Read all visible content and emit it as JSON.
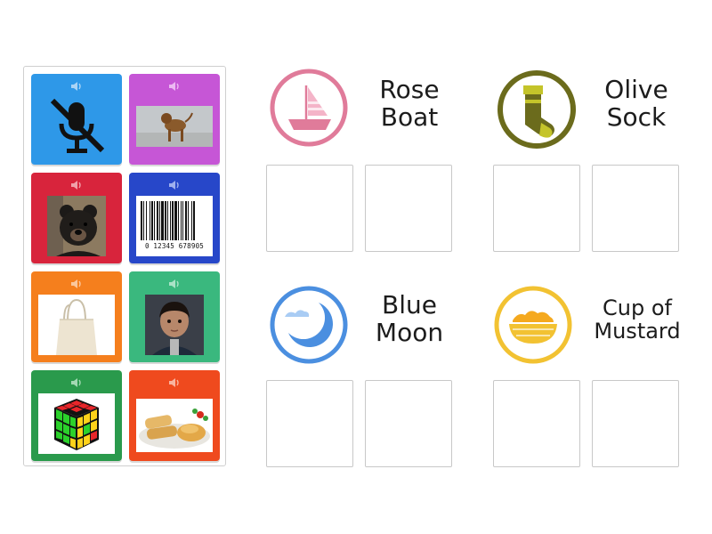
{
  "cards": [
    {
      "name": "mute-card",
      "color": "#2e98e8",
      "icon": "muted-microphone-icon"
    },
    {
      "name": "dog-card",
      "color": "#c656d6",
      "icon": "dog-photo"
    },
    {
      "name": "bear-card",
      "color": "#d8243c",
      "icon": "bear-cub-photo"
    },
    {
      "name": "barcode-card",
      "color": "#2747c9",
      "icon": "barcode-image",
      "barcode_digits": "0 12345 678905"
    },
    {
      "name": "tote-bag-card",
      "color": "#f57f1d",
      "icon": "tote-bag-photo"
    },
    {
      "name": "child-card",
      "color": "#3ab87e",
      "icon": "child-portrait-photo"
    },
    {
      "name": "rubiks-cube-card",
      "color": "#2a9a4c",
      "icon": "rubiks-cube-image"
    },
    {
      "name": "food-plate-card",
      "color": "#ef4a1e",
      "icon": "food-plate-photo"
    }
  ],
  "groups": [
    {
      "id": "rose-boat",
      "title_line1": "Rose",
      "title_line2": "Boat",
      "icon": "sailboat-icon",
      "color": "#e07b9a"
    },
    {
      "id": "olive-sock",
      "title_line1": "Olive",
      "title_line2": "Sock",
      "icon": "sock-icon",
      "color": "#6b6b1c"
    },
    {
      "id": "blue-moon",
      "title_line1": "Blue",
      "title_line2": "Moon",
      "icon": "moon-icon",
      "color": "#4b8fe0"
    },
    {
      "id": "cup-of-mustard",
      "title_line1": "Cup of",
      "title_line2": "Mustard",
      "icon": "mustard-bowl-icon",
      "color": "#f2c232"
    }
  ]
}
